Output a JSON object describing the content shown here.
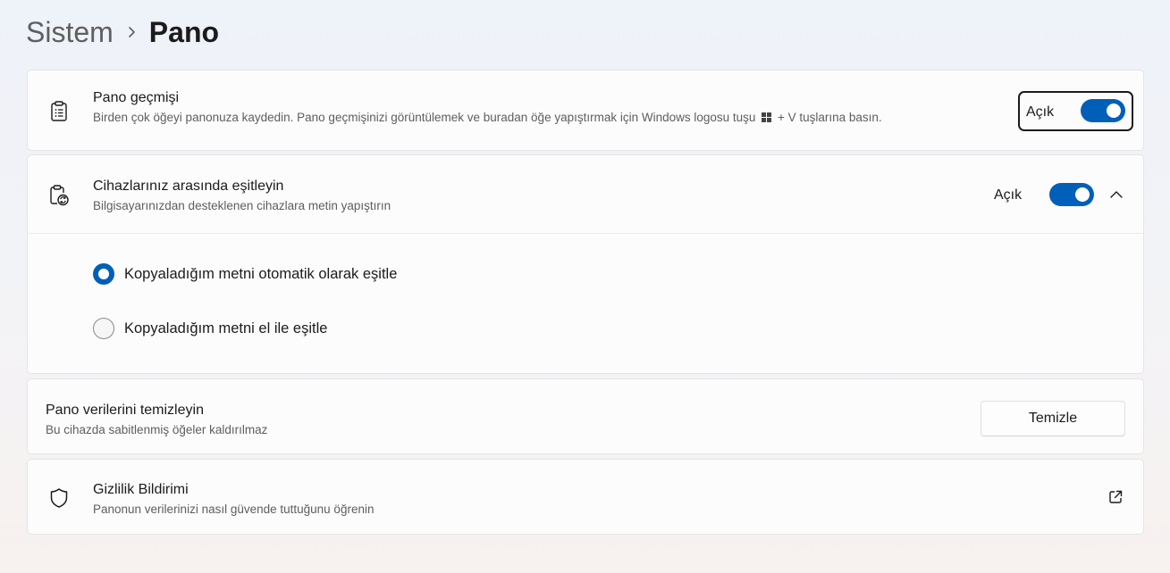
{
  "breadcrumb": {
    "parent": "Sistem",
    "current": "Pano"
  },
  "clipboard_history": {
    "icon": "clipboard-list-icon",
    "title": "Pano geçmişi",
    "description_before": "Birden çok öğeyi panonuza kaydedin. Pano geçmişinizi görüntülemek ve buradan öğe yapıştırmak için Windows logosu tuşu",
    "description_after": "+ V tuşlarına basın.",
    "toggle_state": "Açık"
  },
  "sync_devices": {
    "icon": "clipboard-sync-icon",
    "title": "Cihazlarınız arasında eşitleyin",
    "description": "Bilgisayarınızdan desteklenen cihazlara metin yapıştırın",
    "toggle_state": "Açık",
    "options": [
      {
        "label": "Kopyaladığım metni otomatik olarak eşitle",
        "selected": true
      },
      {
        "label": "Kopyaladığım metni el ile eşitle",
        "selected": false
      }
    ]
  },
  "clear_data": {
    "title": "Pano verilerini temizleyin",
    "description": "Bu cihazda sabitlenmiş öğeler kaldırılmaz",
    "button_label": "Temizle"
  },
  "privacy": {
    "icon": "shield-icon",
    "title": "Gizlilik Bildirimi",
    "description": "Panonun verilerinizi nasıl güvende tuttuğunu öğrenin"
  },
  "colors": {
    "accent": "#005fb8",
    "card": "#fcfcfd",
    "border": "#e4e4e6"
  }
}
